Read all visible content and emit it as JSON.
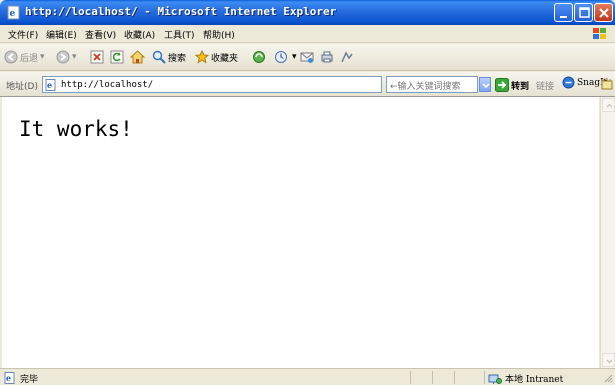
{
  "window": {
    "title": "http://localhost/ - Microsoft Internet Explorer"
  },
  "menu": {
    "items": [
      "文件(F)",
      "编辑(E)",
      "查看(V)",
      "收藏(A)",
      "工具(T)",
      "帮助(H)"
    ]
  },
  "toolbar": {
    "back_label": "后退",
    "search_label": "搜索",
    "favorites_label": "收藏夹"
  },
  "address": {
    "label": "地址(D)",
    "url": "http://localhost/",
    "search_placeholder": "←输入关键词搜索",
    "go_label": "转到",
    "links_label": "链接",
    "snagit_label": "SnagIt"
  },
  "content": {
    "heading": "It works!"
  },
  "status": {
    "text": "完毕",
    "zone": "本地 Intranet"
  },
  "colors": {
    "titlebar": "#2a6fe0",
    "chrome": "#ece9d8"
  }
}
